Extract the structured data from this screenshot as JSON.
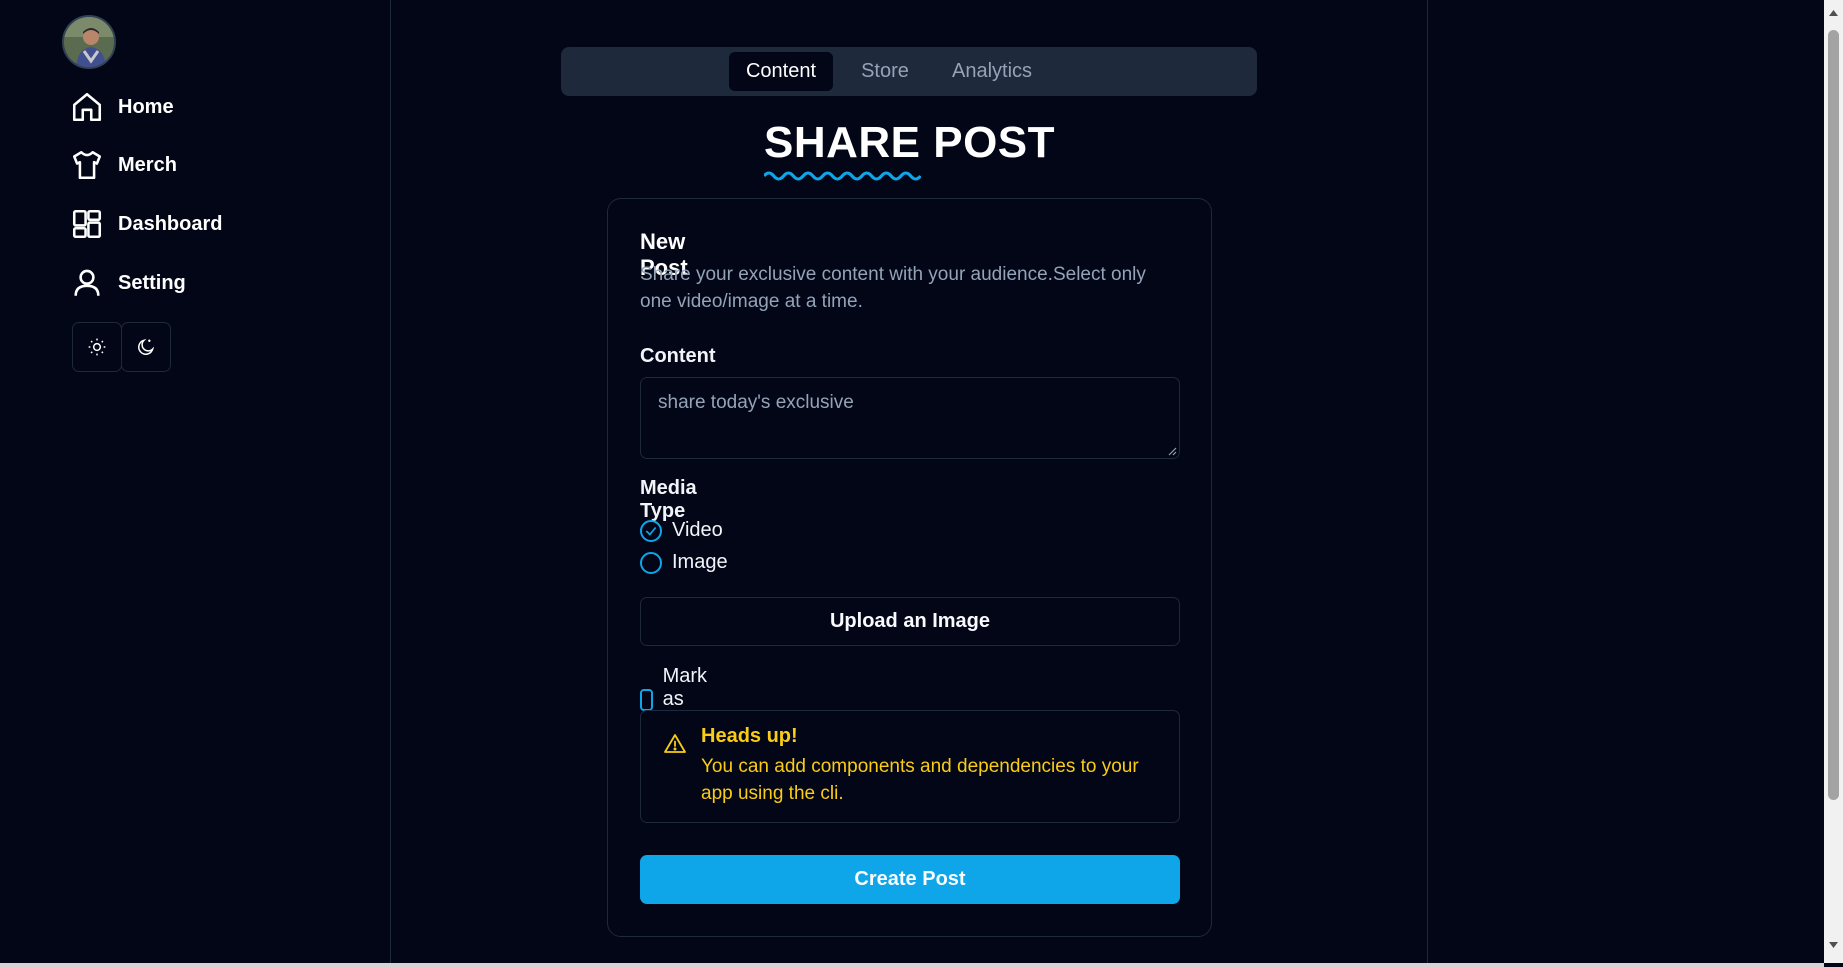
{
  "sidebar": {
    "nav": [
      {
        "label": "Home",
        "icon": "home-icon"
      },
      {
        "label": "Merch",
        "icon": "shirt-icon"
      },
      {
        "label": "Dashboard",
        "icon": "dashboard-icon"
      },
      {
        "label": "Setting",
        "icon": "user-icon"
      }
    ],
    "theme_buttons": [
      "sun-icon",
      "moon-icon"
    ]
  },
  "tabs": [
    {
      "label": "Content",
      "active": true
    },
    {
      "label": "Store",
      "active": false
    },
    {
      "label": "Analytics",
      "active": false
    }
  ],
  "title": {
    "part1": "SHARE",
    "part2": "POST"
  },
  "form": {
    "heading": "New Post",
    "description": "Share your exclusive content with your audience.Select only one video/image at a time.",
    "content_label": "Content",
    "content_placeholder": "share today's exclusive",
    "media_type_label": "Media Type",
    "media_options": [
      {
        "label": "Video",
        "selected": true
      },
      {
        "label": "Image",
        "selected": false
      }
    ],
    "upload_label": "Upload an Image",
    "public_label": "Mark as public",
    "public_checked": false,
    "alert_title": "Heads up!",
    "alert_text": "You can add components and dependencies to your app using the cli.",
    "submit_label": "Create Post"
  },
  "colors": {
    "background": "#020617",
    "border": "#1e293b",
    "accent": "#0ea5e9",
    "warning": "#facc15",
    "muted_text": "#94a3b8"
  }
}
